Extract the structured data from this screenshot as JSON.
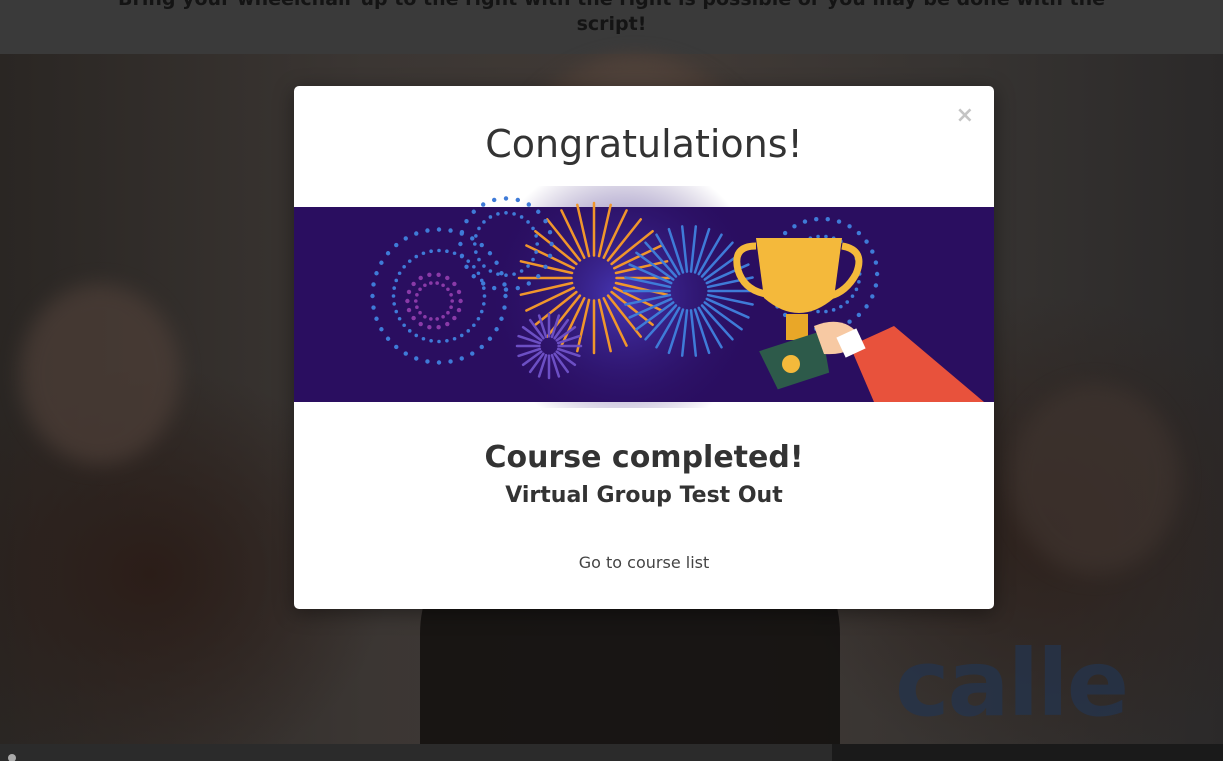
{
  "top_banner": {
    "line1": "Bring your wheelchair up to the right with the right is possible or you may be done with the",
    "line2": "script!"
  },
  "video": {
    "watermark": "calle"
  },
  "modal": {
    "close_glyph": "×",
    "title": "Congratulations!",
    "subtitle": "Course completed!",
    "course_name": "Virtual Group Test Out",
    "link_label": "Go to course list",
    "banner": {
      "background_color": "#2a0e60",
      "trophy_color": "#f4b93b",
      "sleeve_color": "#e8523c",
      "firework_colors": [
        "#f0962c",
        "#3f7bd8",
        "#6c4fc4",
        "#8a3aa8"
      ]
    }
  },
  "player": {
    "progress": 0.68
  }
}
